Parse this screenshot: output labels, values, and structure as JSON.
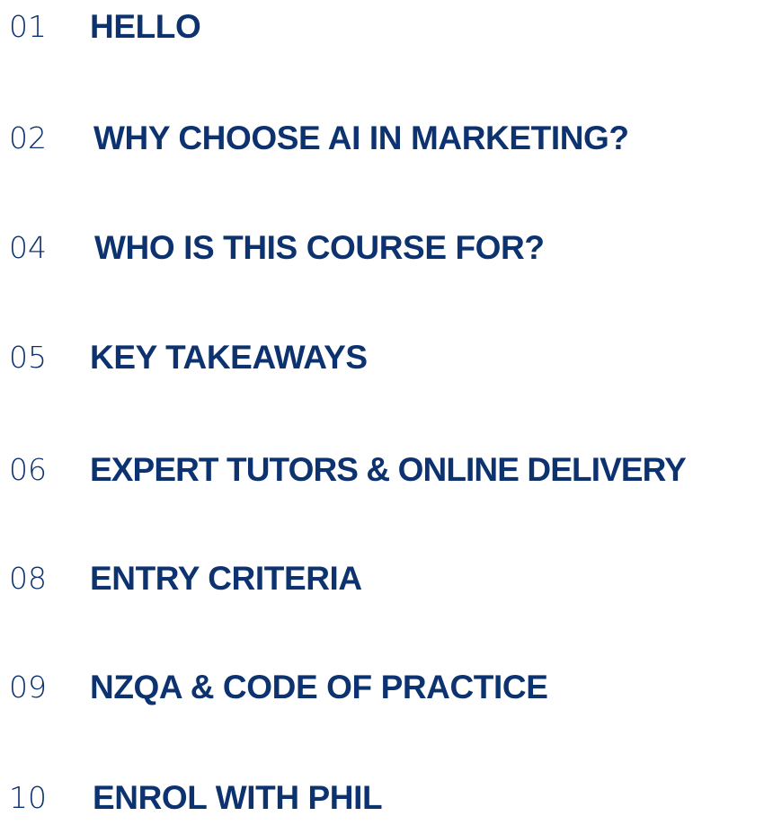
{
  "colors": {
    "text": "#0d3270",
    "background": "#ffffff"
  },
  "toc": {
    "items": [
      {
        "number": "01",
        "title": "HELLO"
      },
      {
        "number": "02",
        "title": "WHY CHOOSE AI IN MARKETING?"
      },
      {
        "number": "04",
        "title": "WHO IS THIS COURSE FOR?"
      },
      {
        "number": "05",
        "title": "KEY TAKEAWAYS"
      },
      {
        "number": "06",
        "title": "EXPERT TUTORS & ONLINE DELIVERY"
      },
      {
        "number": "08",
        "title": "ENTRY CRITERIA"
      },
      {
        "number": "09",
        "title": "NZQA & CODE OF PRACTICE"
      },
      {
        "number": "10",
        "title": "ENROL WITH PHIL"
      }
    ]
  }
}
